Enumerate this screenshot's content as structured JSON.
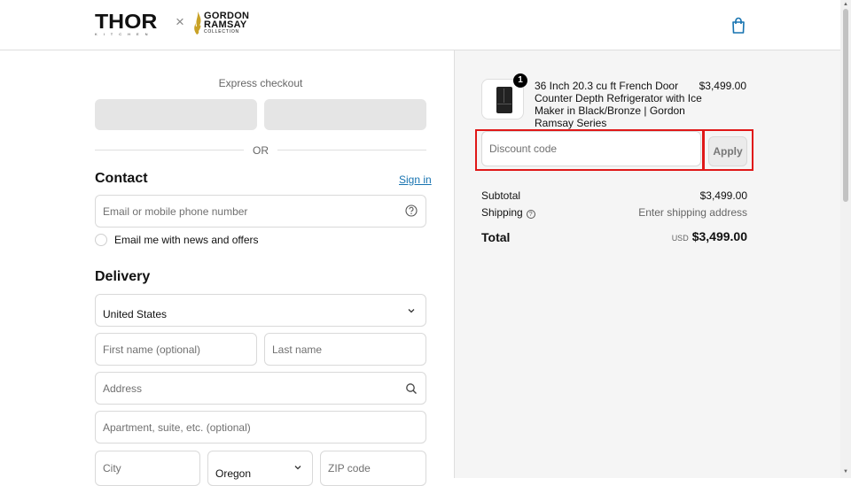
{
  "header": {
    "brand_thor": "THOR",
    "brand_thor_sub": "KITCHEN",
    "brand_separator": "×",
    "brand_gr_line1": "GORDON",
    "brand_gr_line2": "RAMSAY",
    "brand_gr_line3": "COLLECTION",
    "cart_icon": "shopping-bag-icon"
  },
  "express": {
    "title": "Express checkout",
    "divider": "OR"
  },
  "contact": {
    "title": "Contact",
    "sign_in": "Sign in",
    "email_placeholder": "Email or mobile phone number",
    "newsletter_label": "Email me with news and offers"
  },
  "delivery": {
    "title": "Delivery",
    "country": "United States",
    "first_name_placeholder": "First name (optional)",
    "last_name_placeholder": "Last name",
    "address_placeholder": "Address",
    "apartment_placeholder": "Apartment, suite, etc. (optional)",
    "city_placeholder": "City",
    "state": "Oregon",
    "zip_placeholder": "ZIP code"
  },
  "order": {
    "item": {
      "quantity": "1",
      "name": "36 Inch 20.3 cu ft French Door Counter Depth Refrigerator with Ice Maker in Black/Bronze | Gordon Ramsay Series",
      "price": "$3,499.00"
    },
    "discount_placeholder": "Discount code",
    "apply_label": "Apply",
    "subtotal_label": "Subtotal",
    "subtotal_value": "$3,499.00",
    "shipping_label": "Shipping",
    "shipping_value": "Enter shipping address",
    "total_label": "Total",
    "currency": "USD",
    "total_value": "$3,499.00"
  },
  "colors": {
    "link": "#1773b0",
    "highlight": "#e01818",
    "summary_bg": "#f5f5f5"
  }
}
